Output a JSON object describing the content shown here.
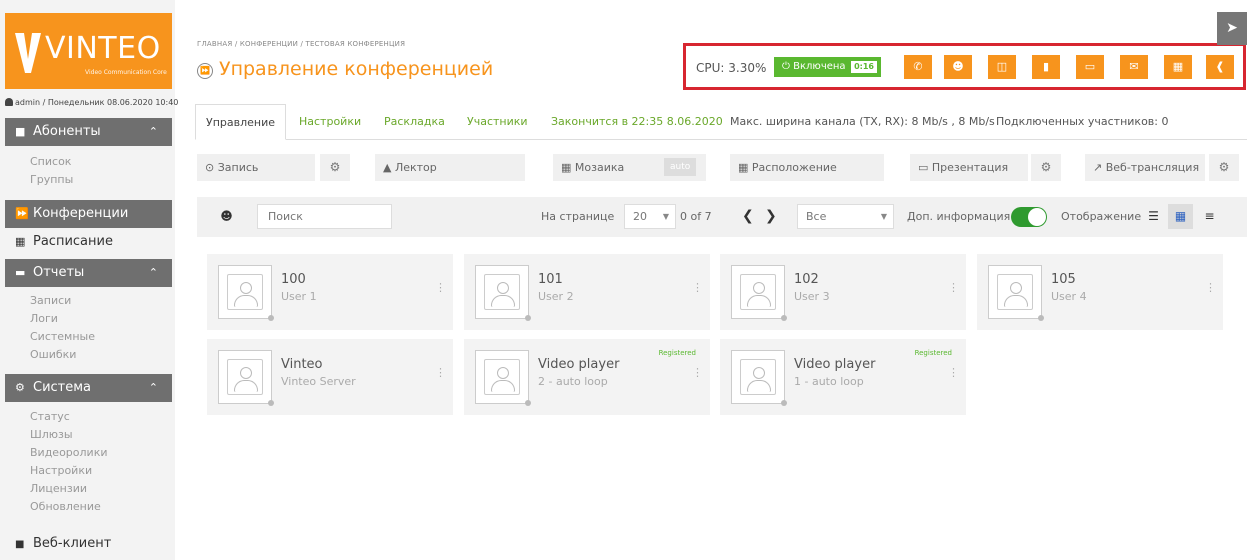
{
  "brand": {
    "name": "VINTEO",
    "subtitle": "Video Communication Core",
    "color": "#f7941d"
  },
  "sidebar": {
    "user_line": "admin / Понедельник 08.06.2020 10:40",
    "subscribers": {
      "label": "Абоненты",
      "items": [
        "Список",
        "Группы"
      ]
    },
    "conferences": {
      "label": "Конференции"
    },
    "schedule": {
      "label": "Расписание"
    },
    "reports": {
      "label": "Отчеты",
      "items": [
        "Записи",
        "Логи",
        "Системные",
        "Ошибки"
      ]
    },
    "system": {
      "label": "Система",
      "items": [
        "Статус",
        "Шлюзы",
        "Видеоролики",
        "Настройки",
        "Лицензии",
        "Обновление"
      ]
    },
    "webclient": {
      "label": "Веб-клиент"
    }
  },
  "header": {
    "breadcrumb": "ГЛАВНАЯ / КОНФЕРЕНЦИИ / ТЕСТОВАЯ КОНФЕРЕНЦИЯ",
    "title": "Управление конференцией",
    "cpu": "CPU: 3.30%",
    "status_label": "Включена",
    "status_timer": "0:16",
    "highlight_color": "#d72630"
  },
  "action_buttons": [
    "phone-icon",
    "add-user-icon",
    "layout-icon",
    "video-icon",
    "screen-icon",
    "mail-icon",
    "book-icon",
    "share-icon"
  ],
  "tabs": {
    "control": "Управление",
    "settings": "Настройки",
    "layout": "Раскладка",
    "participants": "Участники",
    "ends": "Закончится в 22:35 8.06.2020",
    "bandwidth": "Макс. ширина канала (TX, RX): 8 Mb/s , 8 Mb/s",
    "connected": "Подключенных участников: 0"
  },
  "controls": {
    "record": "Запись",
    "lecturer": "Лектор",
    "mosaic": "Мозаика",
    "mosaic_badge": "auto",
    "arrangement": "Расположение",
    "presentation": "Презентация",
    "webcast": "Веб-трансляция"
  },
  "toolbar": {
    "search_placeholder": "Поиск",
    "per_page_label": "На странице",
    "per_page_value": "20",
    "pages": "0 of 7",
    "filter_value": "Все",
    "extra_info_label": "Доп. информация",
    "extra_info_on": true,
    "display_label": "Отображение"
  },
  "participants": [
    {
      "number": "100",
      "name": "User 1",
      "registered": ""
    },
    {
      "number": "101",
      "name": "User 2",
      "registered": ""
    },
    {
      "number": "102",
      "name": "User 3",
      "registered": ""
    },
    {
      "number": "105",
      "name": "User 4",
      "registered": ""
    },
    {
      "number": "Vinteo",
      "name": "Vinteo Server",
      "registered": ""
    },
    {
      "number": "Video player",
      "name": "2 - auto loop",
      "registered": "Registered"
    },
    {
      "number": "Video player",
      "name": "1 - auto loop",
      "registered": "Registered"
    }
  ]
}
